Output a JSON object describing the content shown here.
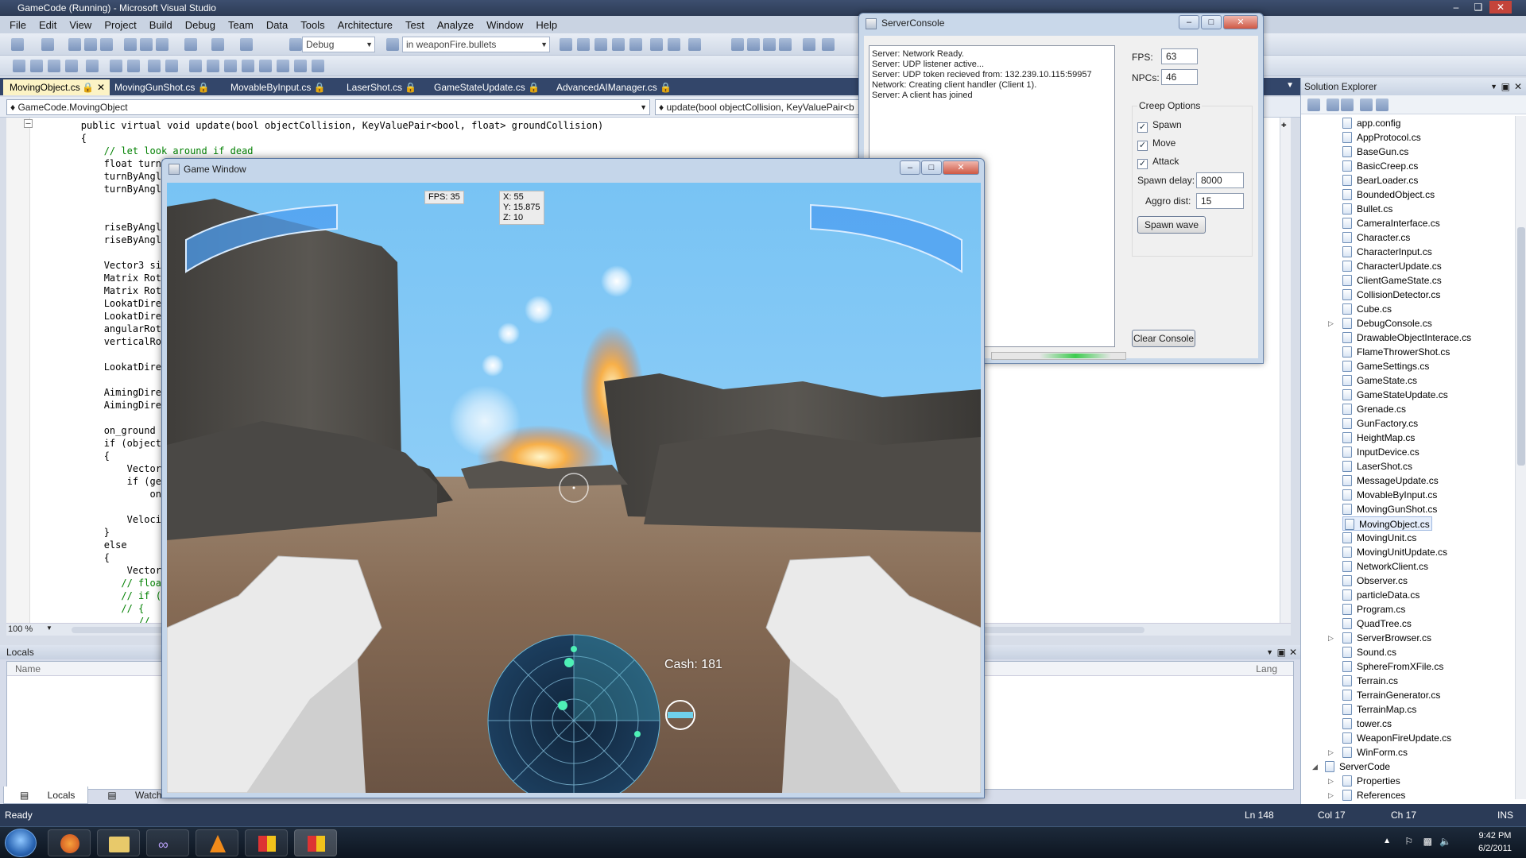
{
  "vs": {
    "title": "GameCode (Running) - Microsoft Visual Studio",
    "menu": [
      "File",
      "Edit",
      "View",
      "Project",
      "Build",
      "Debug",
      "Team",
      "Data",
      "Tools",
      "Architecture",
      "Test",
      "Analyze",
      "Window",
      "Help"
    ],
    "toolbar": {
      "config": "Debug",
      "find": "in weaponFire.bullets"
    },
    "doc_tabs": [
      "MovingObject.cs",
      "MovingGunShot.cs",
      "MovableByInput.cs",
      "LaserShot.cs",
      "GameStateUpdate.cs",
      "AdvancedAIManager.cs"
    ],
    "nav": {
      "left": "GameCode.MovingObject",
      "right": "update(bool objectCollision, KeyValuePair<b"
    },
    "code": [
      "        public virtual void update(bool objectCollision, KeyValuePair<bool, float> groundCollision)",
      "        {",
      "            // let look around if dead",
      "            float turnB",
      "            turnByAngl",
      "            turnByAngl",
      "",
      "",
      "            riseByAngl",
      "            riseByAngl",
      "",
      "            Vector3 si",
      "            Matrix Rot",
      "            Matrix Rot",
      "            LookatDire",
      "            LookatDire",
      "            angularRot",
      "            verticalRo",
      "",
      "            LookatDire",
      "",
      "            AimingDire",
      "            AimingDire",
      "",
      "            on_ground",
      "            if (object",
      "            {",
      "                Vector",
      "                if (ge",
      "                    on",
      "",
      "                Velocit",
      "            }",
      "            else",
      "            {",
      "                Vector",
      "               // floa",
      "               // if (",
      "               // {",
      "                  //"
    ],
    "zoom": "100 %",
    "locals": {
      "title": "Locals",
      "col_name": "Name",
      "col_lang": "Lang"
    },
    "bottom_tabs": [
      "Locals",
      "Watch 1"
    ],
    "solution": {
      "title": "Solution Explorer",
      "items": [
        "app.config",
        "AppProtocol.cs",
        "BaseGun.cs",
        "BasicCreep.cs",
        "BearLoader.cs",
        "BoundedObject.cs",
        "Bullet.cs",
        "CameraInterface.cs",
        "Character.cs",
        "CharacterInput.cs",
        "CharacterUpdate.cs",
        "ClientGameState.cs",
        "CollisionDetector.cs",
        "Cube.cs",
        "DebugConsole.cs",
        "DrawableObjectInterace.cs",
        "FlameThrowerShot.cs",
        "GameSettings.cs",
        "GameState.cs",
        "GameStateUpdate.cs",
        "Grenade.cs",
        "GunFactory.cs",
        "HeightMap.cs",
        "InputDevice.cs",
        "LaserShot.cs",
        "MessageUpdate.cs",
        "MovableByInput.cs",
        "MovingGunShot.cs",
        "MovingObject.cs",
        "MovingUnit.cs",
        "MovingUnitUpdate.cs",
        "NetworkClient.cs",
        "Observer.cs",
        "particleData.cs",
        "Program.cs",
        "QuadTree.cs",
        "ServerBrowser.cs",
        "Sound.cs",
        "SphereFromXFile.cs",
        "Terrain.cs",
        "TerrainGenerator.cs",
        "TerrainMap.cs",
        "tower.cs",
        "WeaponFireUpdate.cs",
        "WinForm.cs"
      ],
      "project2": "ServerCode",
      "project2_items": [
        "Properties",
        "References"
      ]
    },
    "status": {
      "ready": "Ready",
      "ln": "Ln 148",
      "col": "Col 17",
      "ch": "Ch 17",
      "ins": "INS"
    }
  },
  "server": {
    "title": "ServerConsole",
    "log": [
      "Server: Network Ready.",
      "Server: UDP listener active...",
      "Server: UDP token recieved from: 132.239.10.115:59957",
      "Network: Creating client handler (Client 1).",
      "Server: A client has joined"
    ],
    "fps_label": "FPS:",
    "fps": "63",
    "npcs_label": "NPCs:",
    "npcs": "46",
    "creep_title": "Creep Options",
    "spawn": "Spawn",
    "move": "Move",
    "attack": "Attack",
    "delay_label": "Spawn delay:",
    "delay": "8000",
    "aggro_label": "Aggro dist:",
    "aggro": "15",
    "spawn_wave": "Spawn wave",
    "clear": "Clear Console"
  },
  "game": {
    "title": "Game Window",
    "fps": "FPS: 35",
    "coords": [
      "X: 55",
      "Y: 15.875",
      "Z: 10"
    ],
    "cash": "Cash: 181"
  },
  "taskbar": {
    "time": "9:42 PM",
    "date": "6/2/2011"
  }
}
